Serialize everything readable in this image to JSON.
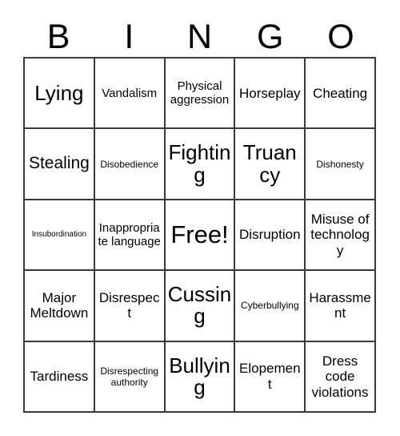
{
  "card": {
    "title": "Bingo Card",
    "header_letters": [
      "B",
      "I",
      "N",
      "G",
      "O"
    ],
    "colors": {
      "background": "#ffffff",
      "grid_line": "#3a3a3a",
      "text": "#000000"
    },
    "rows": [
      [
        {
          "label": "Lying",
          "size": "xl"
        },
        {
          "label": "Vandalism",
          "size": "sm"
        },
        {
          "label": "Physical aggression",
          "size": "sm"
        },
        {
          "label": "Horseplay",
          "size": "md"
        },
        {
          "label": "Cheating",
          "size": "md"
        }
      ],
      [
        {
          "label": "Stealing",
          "size": "lg"
        },
        {
          "label": "Disobedience",
          "size": "xs"
        },
        {
          "label": "Fighting",
          "size": "xl"
        },
        {
          "label": "Truancy",
          "size": "xl"
        },
        {
          "label": "Dishonesty",
          "size": "xs"
        }
      ],
      [
        {
          "label": "Insubordination",
          "size": "xxs"
        },
        {
          "label": "Inappropriate language",
          "size": "sm"
        },
        {
          "label": "Free!",
          "size": "xxl"
        },
        {
          "label": "Disruption",
          "size": "md"
        },
        {
          "label": "Misuse of technology",
          "size": "md"
        }
      ],
      [
        {
          "label": "Major Meltdown",
          "size": "md"
        },
        {
          "label": "Disrespect",
          "size": "md"
        },
        {
          "label": "Cussing",
          "size": "xl"
        },
        {
          "label": "Cyberbullying",
          "size": "xs"
        },
        {
          "label": "Harassment",
          "size": "md"
        }
      ],
      [
        {
          "label": "Tardiness",
          "size": "md"
        },
        {
          "label": "Disrespecting authority",
          "size": "xs"
        },
        {
          "label": "Bullying",
          "size": "xl"
        },
        {
          "label": "Elopement",
          "size": "md"
        },
        {
          "label": "Dress code violations",
          "size": "md"
        }
      ]
    ]
  }
}
